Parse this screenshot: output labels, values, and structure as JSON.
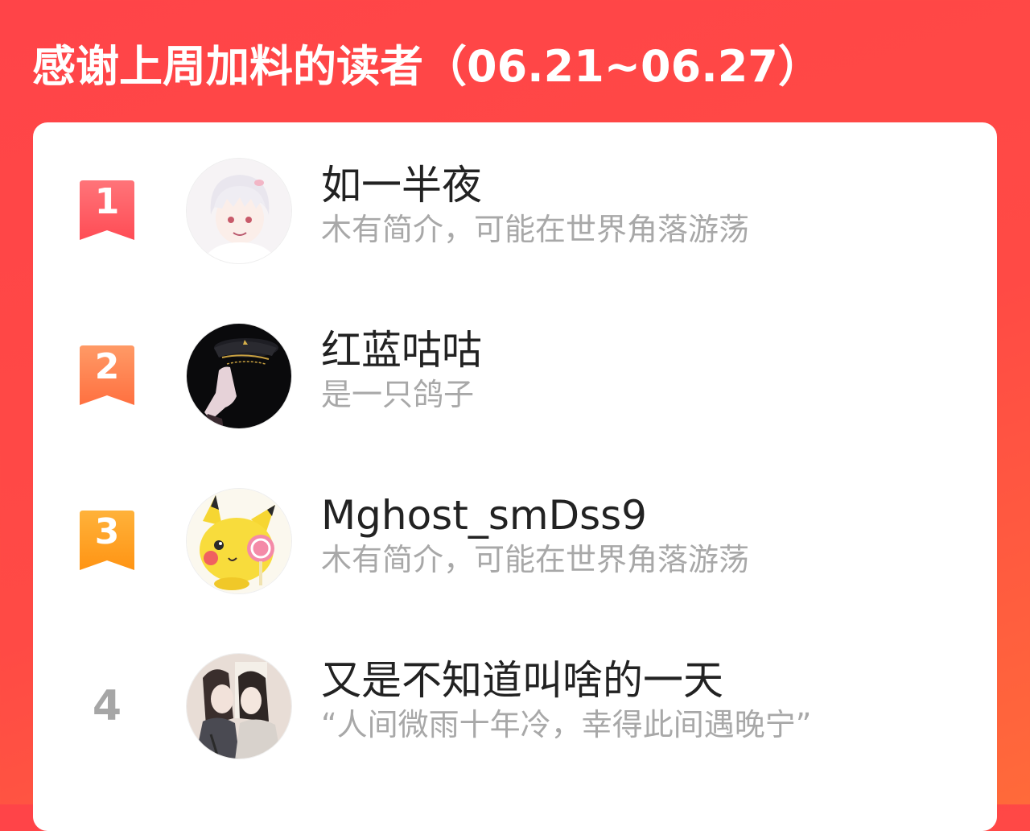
{
  "header": {
    "title": "感谢上周加料的读者（06.21~06.27）"
  },
  "colors": {
    "background": "#ff4448",
    "rank_1": "#ff5a5f",
    "rank_2": "#ff7a45",
    "rank_3": "#ffa020",
    "rank_plain": "#a6a6a6",
    "name": "#222222",
    "bio": "#a8a8a8"
  },
  "readers": [
    {
      "rank": "1",
      "name": "如一半夜",
      "bio": "木有简介，可能在世界角落游荡",
      "avatar_icon": "anime-girl-avatar"
    },
    {
      "rank": "2",
      "name": "红蓝咕咕",
      "bio": "是一只鸽子",
      "avatar_icon": "officer-cap-avatar"
    },
    {
      "rank": "3",
      "name": "Mghost_smDss9",
      "bio": "木有简介，可能在世界角落游荡",
      "avatar_icon": "pikachu-lollipop-avatar"
    },
    {
      "rank": "4",
      "name": "又是不知道叫啥的一天",
      "bio": "“人间微雨十年冷，幸得此间遇晚宁”",
      "avatar_icon": "couple-illustration-avatar"
    }
  ]
}
